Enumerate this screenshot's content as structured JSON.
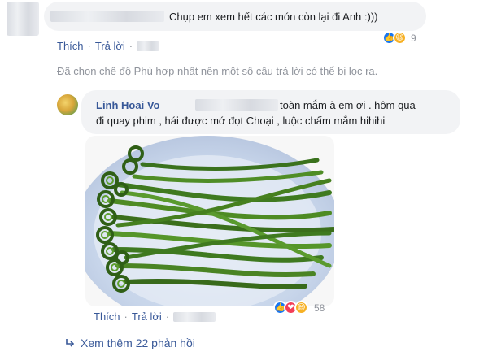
{
  "comment1": {
    "text": "Chụp em xem hết các món còn lại đi Anh :)))",
    "actions": {
      "like": "Thích",
      "reply": "Trả lời"
    },
    "reactions": {
      "count": "9",
      "types": [
        "like-icon",
        "haha-icon"
      ],
      "colors": {
        "like": "#1877f2",
        "haha": "#f7b125"
      }
    }
  },
  "filter_notice": "Đã chọn chế độ Phù hợp nhất nên một số câu trả lời có thể bị lọc ra.",
  "comment2": {
    "author": "Linh Hoai Vo",
    "text_line1": "toàn mắm à em ơi . hôm qua",
    "text_line2": "đi quay phim , hái được mớ đọt Choại , luộc chấm mắm hihihi",
    "actions": {
      "like": "Thích",
      "reply": "Trả lời"
    },
    "reactions": {
      "count": "58",
      "types": [
        "like-icon",
        "love-icon",
        "haha-icon"
      ],
      "colors": {
        "like": "#1877f2",
        "love": "#f33e58",
        "haha": "#f7b125"
      }
    }
  },
  "more_replies": "Xem thêm 22 phản hồi"
}
